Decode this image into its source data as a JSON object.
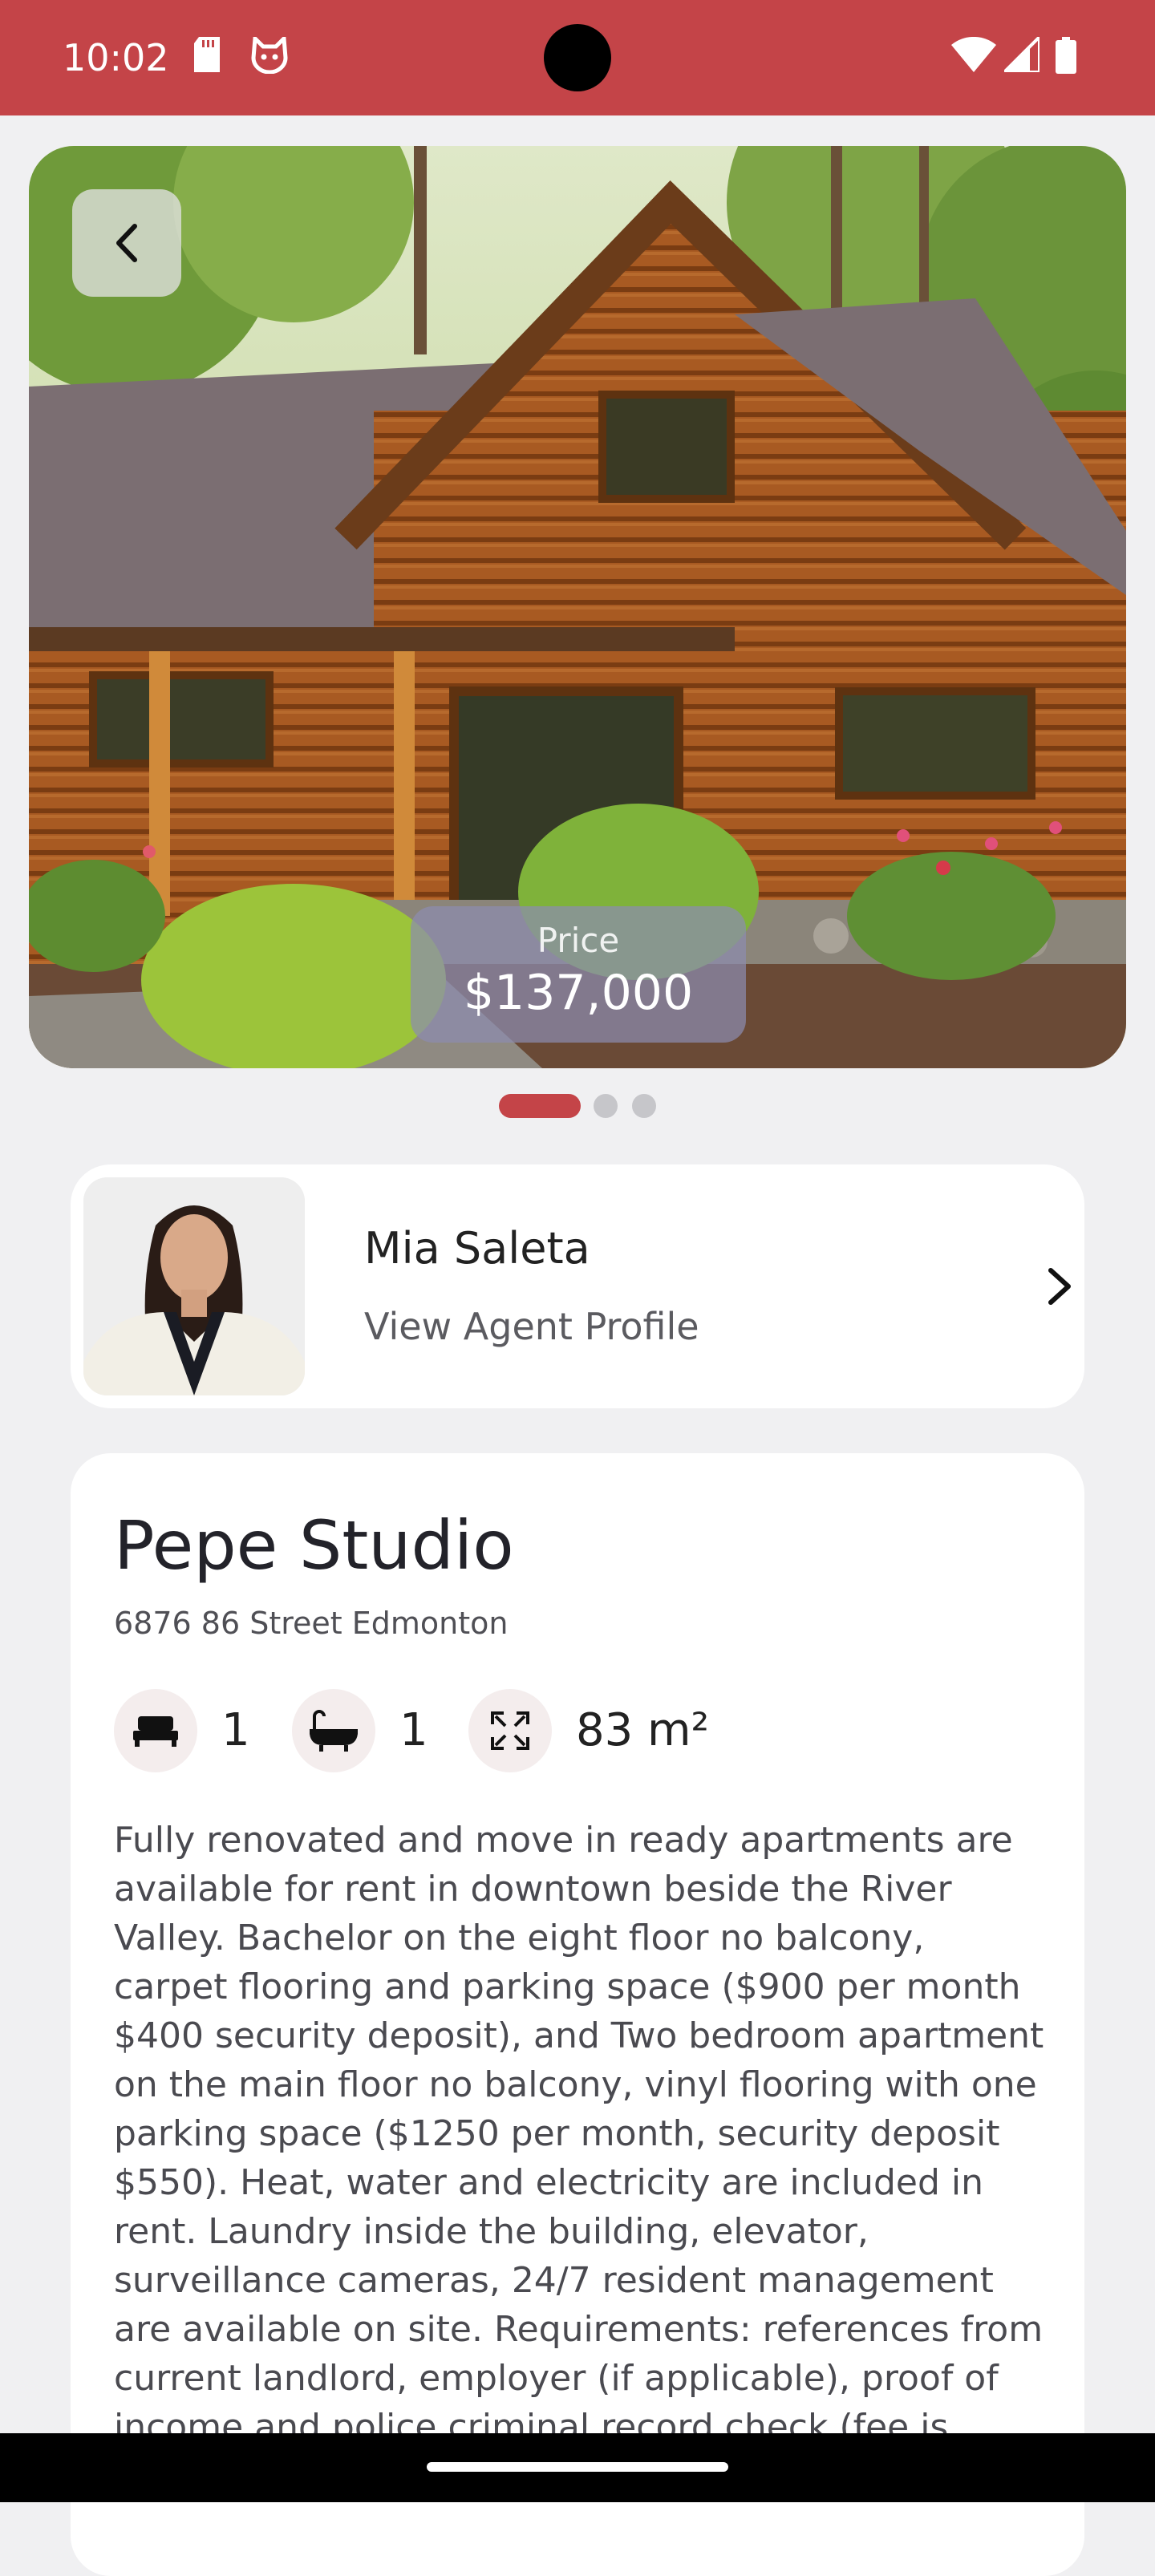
{
  "status_bar": {
    "time": "10:02",
    "icons": [
      "sd-card-icon",
      "cat-face-icon",
      "wifi-icon",
      "signal-icon",
      "battery-icon"
    ],
    "color": "#c44448"
  },
  "hero": {
    "image": "log-cabin-photo",
    "price_label": "Price",
    "price_value": "$137,000",
    "pager": {
      "count": 3,
      "active_index": 0
    }
  },
  "agent": {
    "name": "Mia Saleta",
    "link_label": "View Agent Profile"
  },
  "listing": {
    "title": "Pepe Studio",
    "address": "6876 86 Street Edmonton",
    "features": {
      "bedrooms": "1",
      "bathrooms": "1",
      "area": "83 m²"
    },
    "description": "Fully renovated and move in ready apartments are available for rent in downtown beside the River Valley. Bachelor on the eight floor no balcony, carpet flooring and parking space ($900 per month $400 security deposit), and Two bedroom apartment on the main floor no balcony, vinyl flooring with one parking space ($1250 per month, security deposit $550). Heat, water and electricity are included in rent. Laundry inside the building, elevator, surveillance cameras, 24/7 resident management are available on site. Requirements: references from current landlord, employer (if applicable), proof of income and police criminal record check (fee is"
  },
  "colors": {
    "accent": "#c44448",
    "background": "#f0f0f2",
    "card": "#ffffff"
  }
}
